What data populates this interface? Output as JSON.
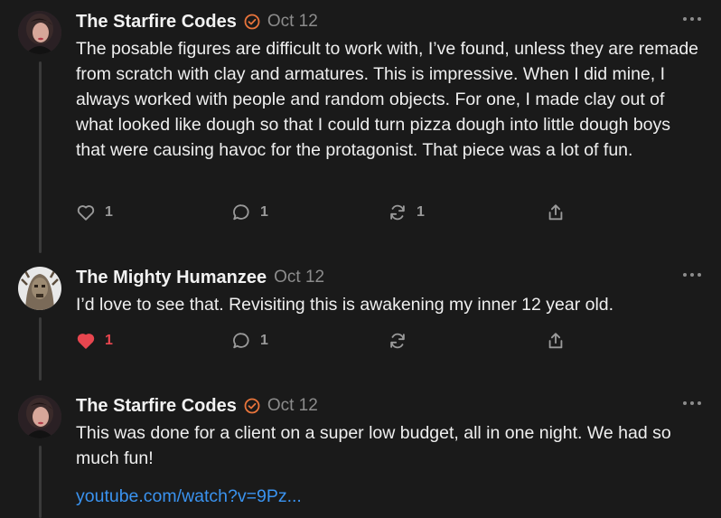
{
  "posts": [
    {
      "author": "The Starfire Codes",
      "verified": true,
      "date": "Oct 12",
      "body": "The posable figures are difficult to work with, I’ve found, unless they are remade from scratch with clay and armatures. This is impressive. When I did mine, I always worked with people and random objects. For one, I made clay out of what looked like dough so that I could turn pizza dough into little dough boys that were causing havoc for the protagonist. That piece was a lot of fun.",
      "likes": "1",
      "comments": "1",
      "restacks": "1",
      "liked": false
    },
    {
      "author": "The Mighty Humanzee",
      "verified": false,
      "date": "Oct 12",
      "body": "I’d love to see that. Revisiting this is awakening my inner 12 year old.",
      "likes": "1",
      "comments": "1",
      "restacks": "",
      "liked": true
    },
    {
      "author": "The Starfire Codes",
      "verified": true,
      "date": "Oct 12",
      "body": "This was done for a client on a super low budget, all in one night. We had so much fun!",
      "link": "youtube.com/watch?v=9Pz..."
    }
  ],
  "colors": {
    "background": "#1a1a1a",
    "verified_badge": "#e8743b",
    "liked_heart": "#e8464f",
    "link": "#3a93f0"
  },
  "icons": [
    "heart-icon",
    "comment-icon",
    "restack-icon",
    "share-icon",
    "more-icon",
    "verified-badge-icon"
  ]
}
